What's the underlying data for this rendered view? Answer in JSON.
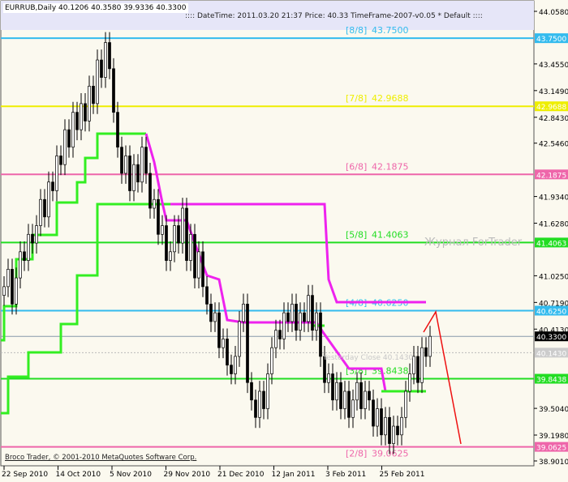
{
  "header": {
    "symbol_info": "EURRUB,Daily  40.1206 40.3580 39.9336 40.3300",
    "info_bar": ":::: DateTime: 2011.03.20 21:37   Price: 40.33   TimeFrame-2007-v0.05   *  Default  ::::"
  },
  "copyright": "Broco Trader, © 2001-2010 MetaQuotes Software Corp.",
  "watermark": "Журнал ForTrader",
  "yesterday_close": "Yesterday Close 40.1430",
  "chart_data": {
    "type": "candlestick",
    "ylim": [
      38.901,
      44.058
    ],
    "y_ticks": [
      "44.0580",
      "43.4550",
      "43.1490",
      "42.8430",
      "42.5460",
      "41.9340",
      "41.6280",
      "41.0250",
      "40.7190",
      "40.4130",
      "39.5040",
      "39.1980",
      "38.9010"
    ],
    "x_ticks": [
      "22 Sep 2010",
      "14 Oct 2010",
      "5 Nov 2010",
      "29 Nov 2010",
      "21 Dec 2010",
      "12 Jan 2011",
      "3 Feb 2011",
      "25 Feb 2011"
    ],
    "closes": [
      40.9,
      41.1,
      40.7,
      41.0,
      41.3,
      41.2,
      41.5,
      41.4,
      41.6,
      41.9,
      41.7,
      42.1,
      42.0,
      42.4,
      42.3,
      42.7,
      42.5,
      42.9,
      42.7,
      43.0,
      42.8,
      43.2,
      43.0,
      43.5,
      43.3,
      43.7,
      43.4,
      42.9,
      42.5,
      42.2,
      42.4,
      42.0,
      42.3,
      42.1,
      42.5,
      42.2,
      41.8,
      41.9,
      41.5,
      41.6,
      41.2,
      41.3,
      41.6,
      41.4,
      41.8,
      41.2,
      41.5,
      41.0,
      41.3,
      40.9,
      40.7,
      40.5,
      40.6,
      40.2,
      40.3,
      40.0,
      39.9,
      40.1,
      40.5,
      40.7,
      39.8,
      39.6,
      39.4,
      39.7,
      39.5,
      39.9,
      40.2,
      40.4,
      40.3,
      40.6,
      40.5,
      40.7,
      40.4,
      40.6,
      40.5,
      40.8,
      40.4,
      40.6,
      40.1,
      39.8,
      39.9,
      39.6,
      39.8,
      39.5,
      39.7,
      39.4,
      39.6,
      39.8,
      39.5,
      39.7,
      39.6,
      39.3,
      39.5,
      39.2,
      39.4,
      39.1,
      39.3,
      39.2,
      39.4,
      39.7,
      39.9,
      40.1,
      39.8,
      40.2,
      40.1,
      40.33
    ],
    "murrey_levels": [
      {
        "name": "[8/8]",
        "value": "43.7500",
        "price": 43.75,
        "color": "#33bbee"
      },
      {
        "name": "[7/8]",
        "value": "42.9688",
        "price": 42.9688,
        "color": "#eeee00"
      },
      {
        "name": "[6/8]",
        "value": "42.1875",
        "price": 42.1875,
        "color": "#ee66aa"
      },
      {
        "name": "[5/8]",
        "value": "41.4063",
        "price": 41.4063,
        "color": "#22dd22"
      },
      {
        "name": "[4/8]",
        "value": "40.6250",
        "price": 40.625,
        "color": "#33bbee"
      },
      {
        "name": "[3/8]",
        "value": "39.8438",
        "price": 39.8438,
        "color": "#22dd22"
      },
      {
        "name": "[2/8]",
        "value": "39.0625",
        "price": 39.0625,
        "color": "#ee66aa"
      }
    ],
    "current_price": {
      "value": "40.3300",
      "price": 40.33
    },
    "yesterday_close_price": {
      "value": "40.1430",
      "price": 40.143
    }
  }
}
